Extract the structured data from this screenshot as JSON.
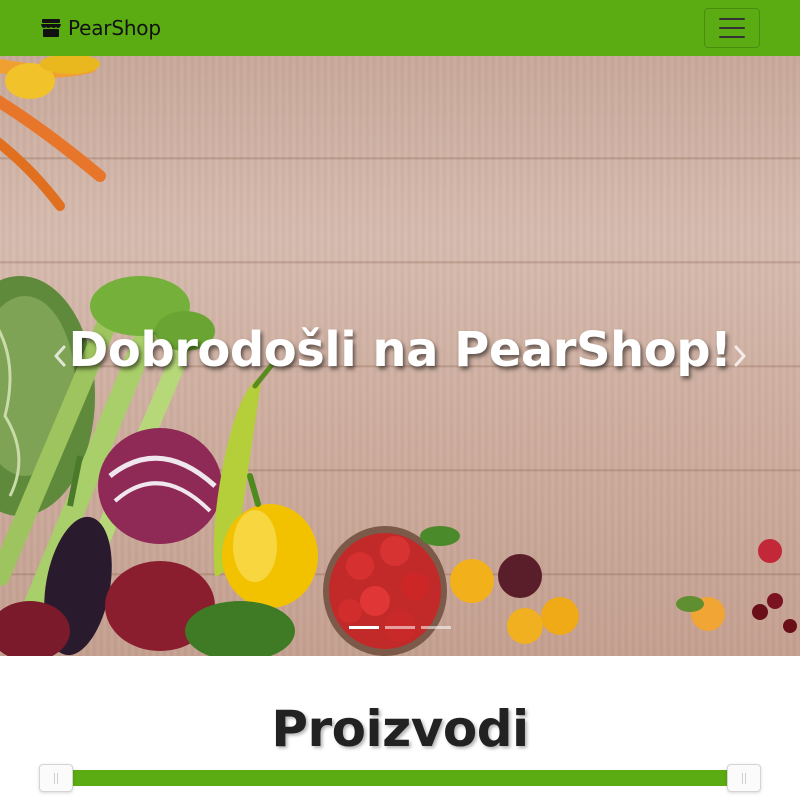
{
  "navbar": {
    "brand_text": "PearShop",
    "brand_icon": "store-icon",
    "toggler_icon": "hamburger-menu-icon",
    "background_color": "#5aac12"
  },
  "hero": {
    "title": "Dobrodošli na PearShop!",
    "slides_count": 3,
    "active_slide": 1,
    "prev_icon": "chevron-left-icon",
    "next_icon": "chevron-right-icon"
  },
  "products": {
    "title": "Proizvodi",
    "slider_accent": "#5aac12"
  }
}
